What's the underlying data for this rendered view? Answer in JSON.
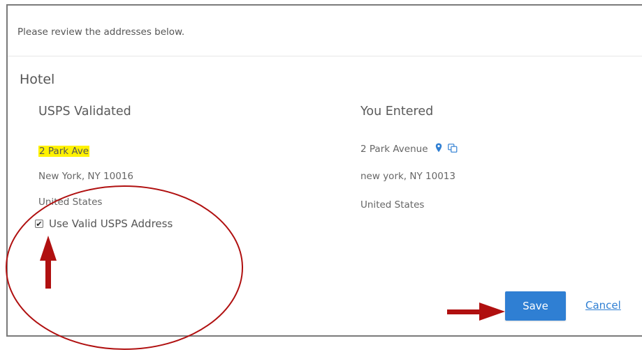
{
  "dialog": {
    "instruction": "Please review the addresses below.",
    "section_title": "Hotel"
  },
  "usps": {
    "heading": "USPS Validated",
    "street": "2 Park Ave",
    "city_state_zip": "New York, NY 10016",
    "country": "United States",
    "checkbox_label": "Use Valid USPS Address",
    "checkbox_checked": true
  },
  "entered": {
    "heading": "You Entered",
    "street": "2 Park Avenue",
    "city_state_zip": "new york, NY 10013",
    "country": "United States"
  },
  "actions": {
    "save_label": "Save",
    "cancel_label": "Cancel"
  },
  "icons": {
    "map_pin": "map-pin-icon",
    "copy": "copy-icon",
    "checkmark": "✔"
  },
  "colors": {
    "highlight": "#fff200",
    "primary_button": "#2f7fd3",
    "annotation_red": "#b01010"
  }
}
